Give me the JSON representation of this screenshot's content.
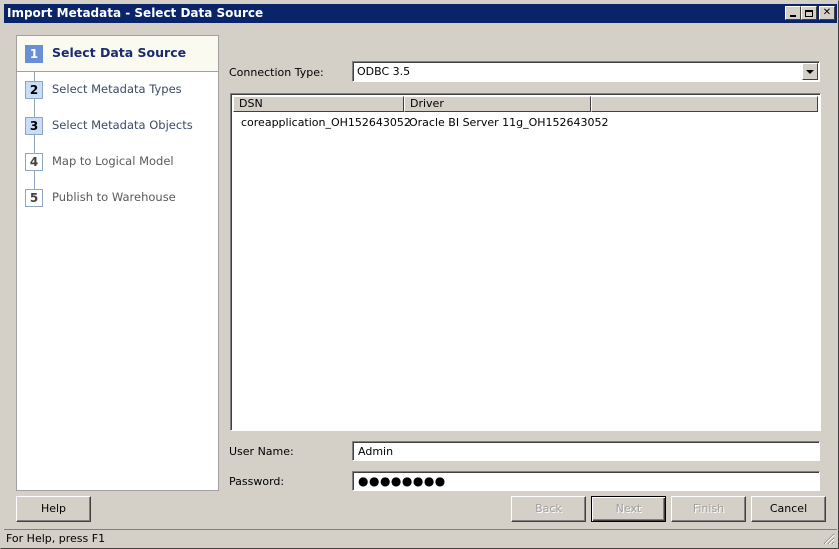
{
  "window": {
    "title": "Import Metadata - Select Data Source",
    "controls": [
      "minimize-icon",
      "maximize-icon",
      "close-icon"
    ]
  },
  "steps": [
    {
      "num": "1",
      "label": "Select Data Source",
      "state": "active"
    },
    {
      "num": "2",
      "label": "Select Metadata Types",
      "state": "visited"
    },
    {
      "num": "3",
      "label": "Select Metadata Objects",
      "state": "visited"
    },
    {
      "num": "4",
      "label": "Map to Logical Model",
      "state": "todo"
    },
    {
      "num": "5",
      "label": "Publish to Warehouse",
      "state": "todo"
    }
  ],
  "form": {
    "connection_type_label": "Connection Type:",
    "connection_type_value": "ODBC 3.5",
    "table": {
      "columns": [
        "DSN",
        "Driver",
        ""
      ],
      "rows": [
        {
          "icon": "database-icon",
          "dsn": "coreapplication_OH152643052",
          "driver": "Oracle BI Server 11g_OH152643052"
        }
      ]
    },
    "username_label": "User Name:",
    "username_value": "Admin",
    "password_label": "Password:",
    "password_value": "●●●●●●●●"
  },
  "buttons": {
    "help": "Help",
    "back": "Back",
    "next": "Next",
    "finish": "Finish",
    "cancel": "Cancel"
  },
  "status": {
    "text": "For Help, press F1"
  }
}
